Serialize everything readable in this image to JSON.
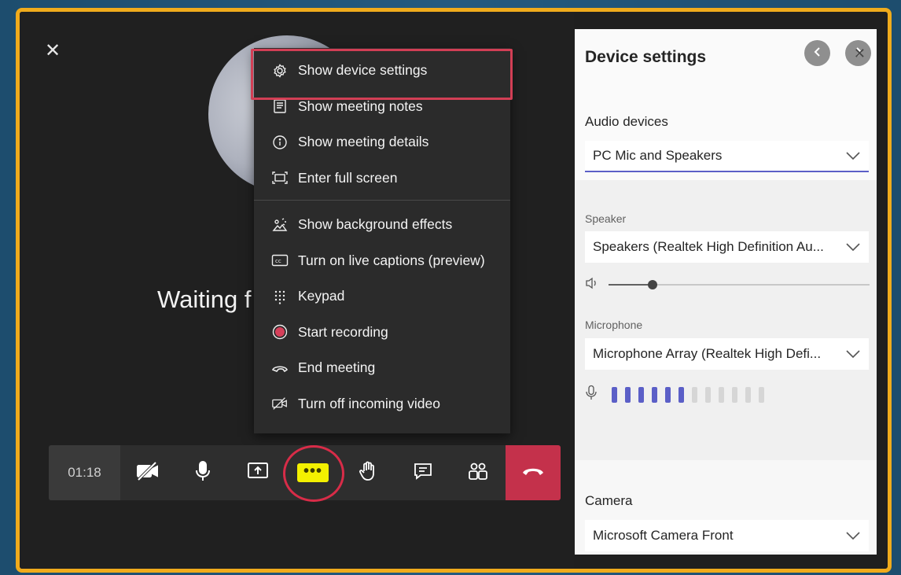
{
  "stage": {
    "close_glyph": "✕",
    "waiting_text": "Waiting f"
  },
  "menu": {
    "items": [
      {
        "label": "Show device settings",
        "icon": "gear-icon"
      },
      {
        "label": "Show meeting notes",
        "icon": "notes-icon"
      },
      {
        "label": "Show meeting details",
        "icon": "info-icon"
      },
      {
        "label": "Enter full screen",
        "icon": "fullscreen-icon"
      },
      {
        "label": "Show background effects",
        "icon": "background-effects-icon"
      },
      {
        "label": "Turn on live captions (preview)",
        "icon": "captions-icon"
      },
      {
        "label": "Keypad",
        "icon": "keypad-icon"
      },
      {
        "label": "Start recording",
        "icon": "record-icon"
      },
      {
        "label": "End meeting",
        "icon": "end-meeting-icon"
      },
      {
        "label": "Turn off incoming video",
        "icon": "video-off-icon"
      }
    ]
  },
  "toolbar": {
    "timer": "01:18",
    "more_label": "•••",
    "buttons": [
      "camera-off-icon",
      "microphone-icon",
      "share-screen-icon",
      "more-options-icon",
      "raise-hand-icon",
      "chat-icon",
      "participants-icon",
      "hang-up-icon"
    ]
  },
  "panel": {
    "title": "Device settings",
    "close_glyph": "✕",
    "audio_devices_label": "Audio devices",
    "audio_device_value": "PC Mic and Speakers",
    "speaker_label": "Speaker",
    "speaker_value": "Speakers (Realtek High Definition Au...",
    "speaker_volume_fraction": 0.17,
    "microphone_label": "Microphone",
    "microphone_value": "Microphone Array (Realtek High Defi...",
    "mic_level_active_bars": 6,
    "mic_level_total_bars": 12,
    "camera_label": "Camera",
    "camera_value": "Microsoft Camera Front"
  },
  "colors": {
    "frame_border": "#f0ab1c",
    "highlight": "#d23f55",
    "hang_up": "#c4314b",
    "more_highlight": "#f3f000",
    "meter_active": "#5b5fc7",
    "meter_inactive": "#d6d6d6"
  }
}
